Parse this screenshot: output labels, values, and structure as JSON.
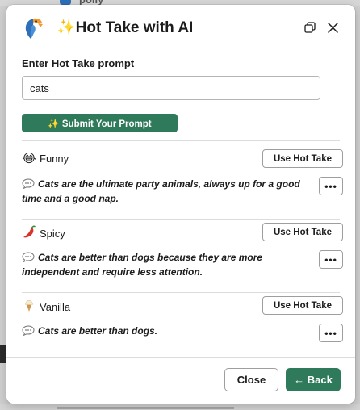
{
  "background": {
    "app_name": "polly"
  },
  "header": {
    "title": "✨Hot Take with AI",
    "logo_icon": "parrot-logo-icon",
    "expand_icon": "expand-window-icon",
    "close_icon": "close-icon"
  },
  "prompt": {
    "label": "Enter Hot Take prompt",
    "value": "cats",
    "submit_label": "✨ Submit Your Prompt"
  },
  "takes": [
    {
      "emoji": "😂",
      "emoji_icon": "laughing-face-icon",
      "name": "Funny",
      "use_label": "Use Hot Take",
      "text": "Cats are the ultimate party animals, always up for a good time and a good nap.",
      "more_label": "•••"
    },
    {
      "emoji": "🌶",
      "emoji_icon": "hot-pepper-icon",
      "name": "Spicy",
      "use_label": "Use Hot Take",
      "text": "Cats are better than dogs because they are more independent and require less attention.",
      "more_label": "•••"
    },
    {
      "emoji": "🍦",
      "emoji_icon": "ice-cream-icon",
      "name": "Vanilla",
      "use_label": "Use Hot Take",
      "text": "Cats are better than dogs.",
      "more_label": "•••"
    }
  ],
  "footer": {
    "close_label": "Close",
    "back_label": "← Back"
  },
  "colors": {
    "primary_green": "#2f7a5a",
    "logo_blue": "#2d6fb8",
    "logo_orange": "#f29a2e"
  }
}
